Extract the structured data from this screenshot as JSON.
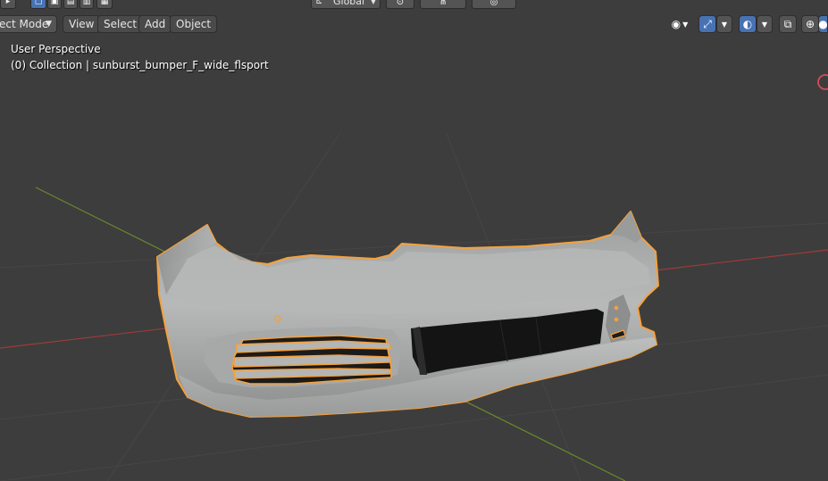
{
  "toolstrip": {
    "orientation_label": "Global"
  },
  "header": {
    "mode_label": "ect Mode",
    "menu": [
      {
        "label": "View"
      },
      {
        "label": "Select"
      },
      {
        "label": "Add"
      },
      {
        "label": "Object"
      }
    ]
  },
  "overlay": {
    "perspective": "User Perspective",
    "collection_path": "(0) Collection | sunburst_bumper_F_wide_flsport"
  },
  "icons": {
    "visibility": "eye-icon",
    "gizmo": "gizmo-icon",
    "overlays": "overlays-icon",
    "xray": "xray-icon",
    "shading_wire": "wireframe-shading-icon",
    "shading_solid": "solid-shading-icon"
  },
  "colors": {
    "viewport_bg": "#3d3d3d",
    "selection_outline": "#f5a13a",
    "axis_x": "#9e3a3a",
    "axis_y": "#6a8a2c",
    "active_blue": "#4772b3",
    "mesh_grey": "#a8a9a9"
  }
}
